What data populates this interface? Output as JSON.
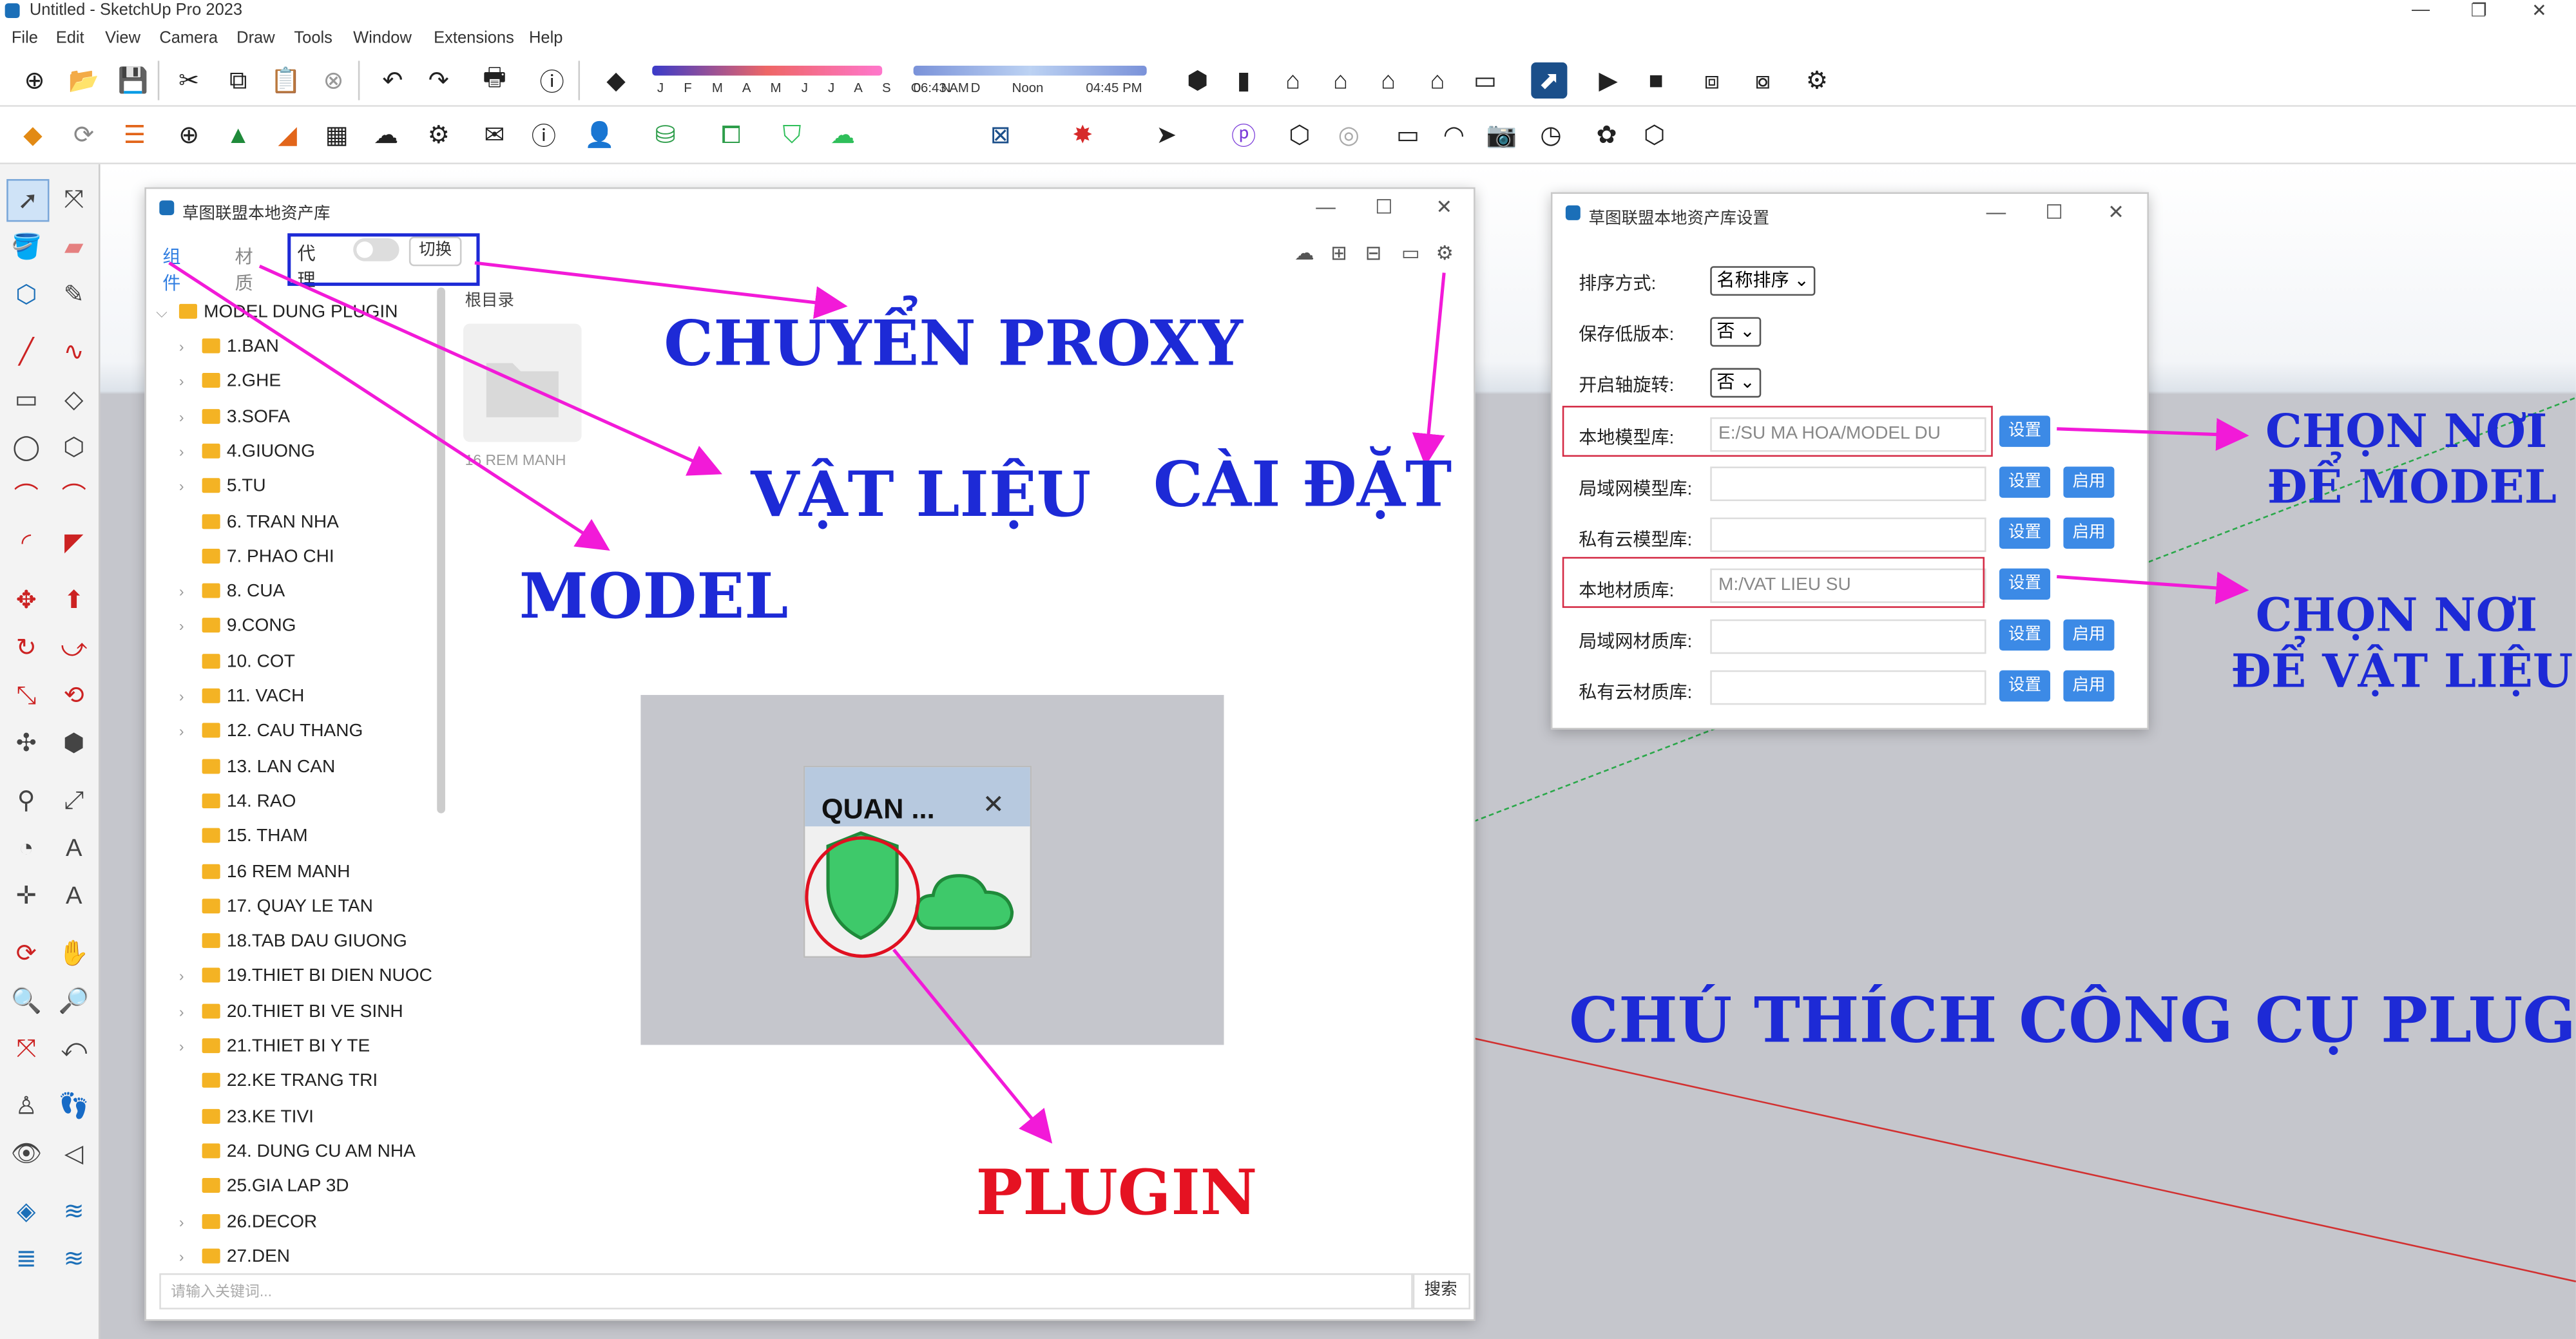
{
  "app": {
    "title": "Untitled - SketchUp Pro 2023",
    "menu": [
      "File",
      "Edit",
      "View",
      "Camera",
      "Draw",
      "Tools",
      "Window",
      "Extensions",
      "Help"
    ]
  },
  "shadow": {
    "months": "J F M A M J J A S O N D",
    "time_start": "06:43 AM",
    "time_mid": "Noon",
    "time_end": "04:45 PM"
  },
  "library_window": {
    "title": "草图联盟本地资产库",
    "tab_components": "组件",
    "tab_materials": "材质",
    "proxy_label": "代理",
    "switch_button": "切换",
    "root_label": "根目录",
    "thumb_label": "16 REM MANH",
    "search_placeholder": "请输入关键词...",
    "search_button": "搜索",
    "tree_root": "MODEL DUNG PLUGIN",
    "tree": [
      "1.BAN",
      "2.GHE",
      "3.SOFA",
      "4.GIUONG",
      "5.TU",
      "6. TRAN NHA",
      "7. PHAO CHI",
      "8. CUA",
      "9.CONG",
      "10. COT",
      "11. VACH",
      "12. CAU THANG",
      "13. LAN CAN",
      "14. RAO",
      "15. THAM",
      "16 REM MANH",
      "17. QUAY LE TAN",
      "18.TAB DAU GIUONG",
      "19.THIET BI DIEN NUOC",
      "20.THIET BI VE SINH",
      "21.THIET BI Y TE",
      "22.KE TRANG TRI",
      "23.KE TIVI",
      "24. DUNG CU AM NHA",
      "25.GIA LAP 3D",
      "26.DECOR",
      "27.DEN"
    ]
  },
  "quan_panel": {
    "title": "QUAN ...",
    "close": "✕"
  },
  "settings_window": {
    "title": "草图联盟本地资产库设置",
    "sort_label": "排序方式:",
    "sort_value": "名称排序",
    "low_version_label": "保存低版本:",
    "low_version_value": "否",
    "axis_rotate_label": "开启轴旋转:",
    "axis_rotate_value": "否",
    "rows": [
      {
        "label": "本地模型库:",
        "value": "E:/SU MA HOA/MODEL DU",
        "btn": "设置",
        "enable": ""
      },
      {
        "label": "局域网模型库:",
        "value": "",
        "btn": "设置",
        "enable": "启用"
      },
      {
        "label": "私有云模型库:",
        "value": "",
        "btn": "设置",
        "enable": "启用"
      },
      {
        "label": "本地材质库:",
        "value": "M:/VAT LIEU SU",
        "btn": "设置",
        "enable": ""
      },
      {
        "label": "局域网材质库:",
        "value": "",
        "btn": "设置",
        "enable": "启用"
      },
      {
        "label": "私有云材质库:",
        "value": "",
        "btn": "设置",
        "enable": "启用"
      }
    ]
  },
  "annotations": {
    "proxy": "CHUYỂN PROXY",
    "material": "VẬT LIỆU",
    "model": "MODEL",
    "settings": "CÀI ĐẶT",
    "model_place_1": "CHỌN NƠI",
    "model_place_2": "ĐỂ MODEL",
    "mat_place_1": "CHỌN NƠI",
    "mat_place_2": "ĐỂ VẬT LIỆU",
    "caption": "CHÚ THÍCH CÔNG CỤ PLUGIN",
    "plugin": "PLUGIN"
  },
  "colors": {
    "annotation_blue": "#1d2ad6",
    "annotation_red": "#e51222",
    "arrow_magenta": "#f21ad8",
    "accent_blue": "#3c8ae6",
    "folder_yellow": "#f4b324"
  }
}
